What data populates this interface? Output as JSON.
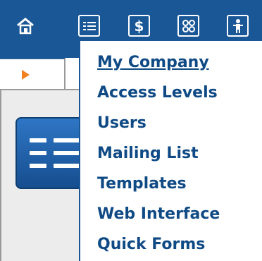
{
  "toolbar": {
    "background": "#1a5796",
    "buttons": [
      {
        "icon": "home-icon"
      },
      {
        "icon": "list-icon"
      },
      {
        "icon": "dollar-icon"
      },
      {
        "icon": "modules-icon"
      },
      {
        "icon": "person-icon"
      }
    ],
    "dollar_glyph": "$"
  },
  "menu": {
    "color": "#0f4a85",
    "items": [
      {
        "label": "My Company",
        "active": true
      },
      {
        "label": "Access Levels"
      },
      {
        "label": "Users"
      },
      {
        "label": "Mailing List"
      },
      {
        "label": "Templates"
      },
      {
        "label": "Web Interface"
      },
      {
        "label": "Quick Forms"
      }
    ]
  }
}
